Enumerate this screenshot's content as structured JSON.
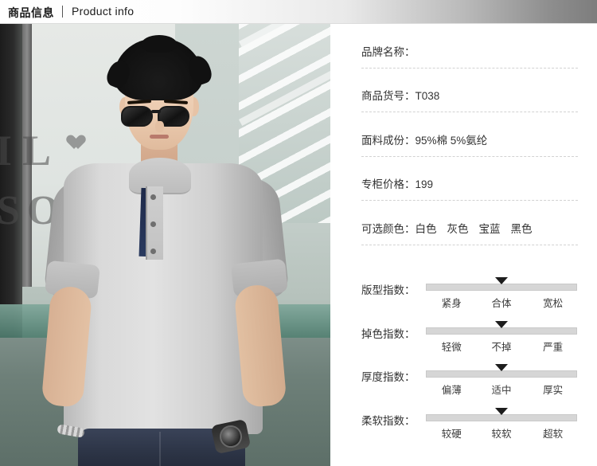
{
  "header": {
    "title_cn": "商品信息",
    "title_en": "Product info"
  },
  "photo": {
    "alt": "男模特身穿灰色立领短袖POLO衫",
    "background_letters": [
      "I",
      "L",
      "S",
      "O"
    ]
  },
  "info": {
    "rows": [
      {
        "label": "品牌名称：",
        "value": ""
      },
      {
        "label": "商品货号：",
        "value": "T038"
      },
      {
        "label": "面料成份：",
        "value": "95%棉  5%氨纶"
      },
      {
        "label": "专柜价格：",
        "value": "199"
      },
      {
        "label": "可选颜色：",
        "value": "白色  灰色  宝蓝  黑色",
        "colors": [
          "白色",
          "灰色",
          "宝蓝",
          "黑色"
        ]
      }
    ]
  },
  "indices": [
    {
      "label": "版型指数：",
      "ticks": [
        "紧身",
        "合体",
        "宽松"
      ],
      "marker_percent": 50
    },
    {
      "label": "掉色指数：",
      "ticks": [
        "轻微",
        "不掉",
        "严重"
      ],
      "marker_percent": 50
    },
    {
      "label": "厚度指数：",
      "ticks": [
        "偏薄",
        "适中",
        "厚实"
      ],
      "marker_percent": 50
    },
    {
      "label": "柔软指数：",
      "ticks": [
        "较硬",
        "较软",
        "超软"
      ],
      "marker_percent": 50
    }
  ],
  "palette": {
    "header_text": "#1a1a1a",
    "body_text": "#333333",
    "dashed_rule": "#d2d2d2",
    "slider_track": "#d6d6d6",
    "slider_marker": "#1d1d1d",
    "shirt_gray": "#d9d9d9",
    "placket_navy": "#22304f"
  }
}
